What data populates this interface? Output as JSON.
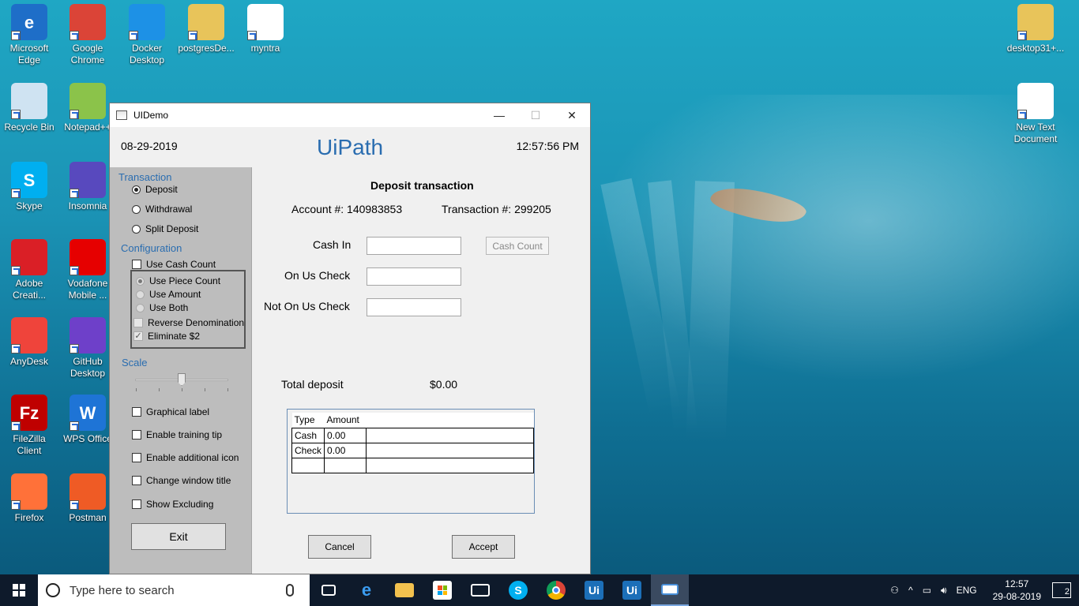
{
  "desktop": {
    "icons": [
      {
        "label": "Microsoft Edge",
        "glyph": "e",
        "color": "#1e6ec8"
      },
      {
        "label": "Google Chrome",
        "glyph": "",
        "color": "#db4437"
      },
      {
        "label": "Docker Desktop",
        "glyph": "",
        "color": "#1d91e6"
      },
      {
        "label": "postgresDe...",
        "glyph": "",
        "color": "#e8c45a"
      },
      {
        "label": "myntra",
        "glyph": "",
        "color": "#ffffff"
      },
      {
        "label": "desktop31+...",
        "glyph": "",
        "color": "#e8c45a"
      },
      {
        "label": "Recycle Bin",
        "glyph": "",
        "color": "#cfe3f2"
      },
      {
        "label": "Notepad++",
        "glyph": "",
        "color": "#8bc34a"
      },
      {
        "label": "New Text Document",
        "glyph": "",
        "color": "#ffffff"
      },
      {
        "label": "Skype",
        "glyph": "S",
        "color": "#00aff0"
      },
      {
        "label": "Insomnia",
        "glyph": "",
        "color": "#5849be"
      },
      {
        "label": "Adobe Creati...",
        "glyph": "",
        "color": "#da1f26"
      },
      {
        "label": "Vodafone Mobile ...",
        "glyph": "",
        "color": "#e60000"
      },
      {
        "label": "AnyDesk",
        "glyph": "",
        "color": "#ef443b"
      },
      {
        "label": "GitHub Desktop",
        "glyph": "",
        "color": "#6e40c9"
      },
      {
        "label": "FileZilla Client",
        "glyph": "Fz",
        "color": "#bf0000"
      },
      {
        "label": "WPS Office",
        "glyph": "W",
        "color": "#1e74d6"
      },
      {
        "label": "Firefox",
        "glyph": "",
        "color": "#ff7139"
      },
      {
        "label": "Postman",
        "glyph": "",
        "color": "#ef5b25"
      }
    ]
  },
  "window": {
    "title": "UIDemo",
    "minimize": "—",
    "maximize": "☐",
    "close": "✕",
    "date": "08-29-2019",
    "brand": "UiPath",
    "time": "12:57:56 PM"
  },
  "sidebar": {
    "transaction_header": "Transaction",
    "transaction_options": [
      {
        "label": "Deposit",
        "selected": true
      },
      {
        "label": "Withdrawal",
        "selected": false
      },
      {
        "label": "Split Deposit",
        "selected": false
      }
    ],
    "configuration_header": "Configuration",
    "use_cash_count": "Use Cash Count",
    "count_options": [
      {
        "label": "Use Piece Count",
        "selected": true
      },
      {
        "label": "Use Amount",
        "selected": false
      },
      {
        "label": "Use Both",
        "selected": false
      }
    ],
    "reverse_denomination": "Reverse Denomination",
    "eliminate_2": "Eliminate $2",
    "scale_header": "Scale",
    "checkboxes": [
      "Graphical label",
      "Enable training tip",
      "Enable additional icon",
      "Change window title",
      "Show Excluding"
    ],
    "exit_label": "Exit"
  },
  "main": {
    "heading": "Deposit transaction",
    "account": "Account #: 140983853",
    "transaction": "Transaction #: 299205",
    "cash_in_label": "Cash In",
    "cash_count_button": "Cash Count",
    "on_us_check_label": "On Us Check",
    "not_on_us_check_label": "Not On Us Check",
    "total_label": "Total deposit",
    "total_value": "$0.00",
    "grid": {
      "headers": [
        "Type",
        "Amount"
      ],
      "rows": [
        [
          "Cash",
          "0.00"
        ],
        [
          "Check",
          "0.00"
        ],
        [
          "",
          ""
        ]
      ]
    },
    "cancel_label": "Cancel",
    "accept_label": "Accept"
  },
  "taskbar": {
    "search_placeholder": "Type here to search",
    "language": "ENG",
    "time": "12:57",
    "date": "29-08-2019",
    "notifications": "2"
  }
}
